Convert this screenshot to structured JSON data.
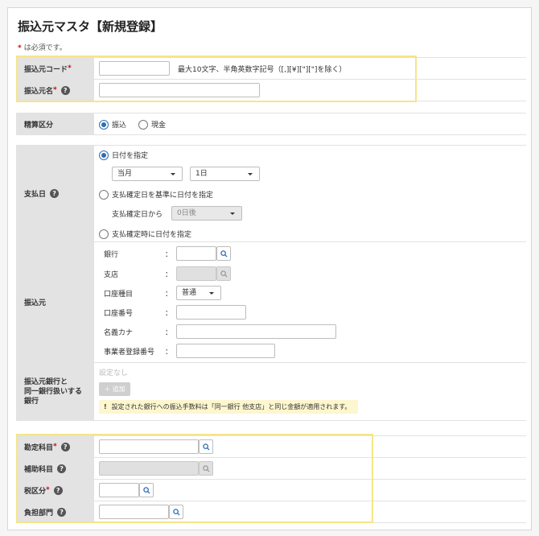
{
  "page": {
    "title": "振込元マスタ【新規登録】",
    "required_note": "は必須です。",
    "required_mark": "*"
  },
  "section1": {
    "code_label": "振込元コード",
    "code_hint": "最大10文字、半角英数字記号（[,][¥][\"][\"]を除く）",
    "name_label": "振込元名"
  },
  "settlement": {
    "label": "精算区分",
    "option1": "振込",
    "option2": "現金"
  },
  "payday": {
    "label": "支払日",
    "opt1": "日付を指定",
    "month_select": "当月",
    "day_select": "1日",
    "opt2": "支払確定日を基準に日付を指定",
    "from_label": "支払確定日から",
    "offset_select": "0日後",
    "opt3": "支払確定時に日付を指定"
  },
  "source": {
    "label": "振込元",
    "colon": "：",
    "bank": "銀行",
    "branch": "支店",
    "account_type": "口座種目",
    "account_type_value": "普通",
    "account_no": "口座番号",
    "holder_kana": "名義カナ",
    "business_no": "事業者登録番号"
  },
  "samebank": {
    "label_line1": "振込元銀行と",
    "label_line2": "同一銀行扱いする",
    "label_line3": "銀行",
    "none_text": "設定なし",
    "add_button": "＋ 追加",
    "warning": "設定された銀行への振込手数料は「同一銀行 他支店」と同じ金額が適用されます。",
    "warning_mark": "!"
  },
  "accounting": {
    "account_label": "勘定科目",
    "sub_label": "補助科目",
    "tax_label": "税区分",
    "dept_label": "負担部門"
  },
  "colors": {
    "highlight": "#f5e58a",
    "radio_on": "#2d6db5",
    "required": "#d0021b"
  }
}
